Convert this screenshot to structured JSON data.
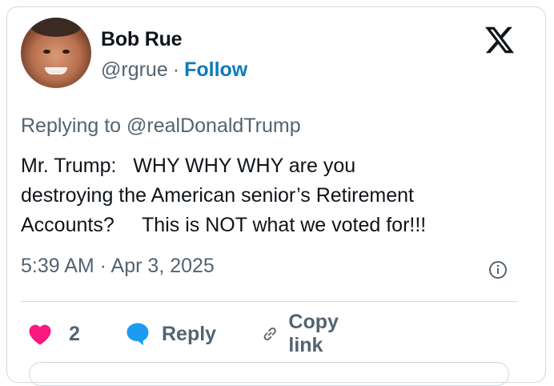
{
  "author": {
    "name": "Bob Rue",
    "handle": "@rgrue",
    "separator": "·",
    "follow_label": "Follow"
  },
  "reply_context": {
    "prefix": "Replying to ",
    "mention": "@realDonaldTrump"
  },
  "tweet": {
    "text": "Mr. Trump:   WHY WHY WHY are you\ndestroying the American senior’s Retirement\nAccounts?     This is NOT what we voted for!!!",
    "timestamp": "5:39 AM · Apr 3, 2025"
  },
  "actions": {
    "like_count": "2",
    "reply_label": "Reply",
    "copy_link_label": "Copy link"
  },
  "icons": {
    "logo": "x-logo-icon",
    "info": "info-icon",
    "like": "heart-icon",
    "reply": "reply-bubble-icon",
    "copy": "link-icon"
  },
  "colors": {
    "accent": "#0c7abf",
    "like": "#f91880",
    "reply_icon": "#1d9bf0",
    "secondary_text": "#536471",
    "border": "#cfd9de"
  }
}
